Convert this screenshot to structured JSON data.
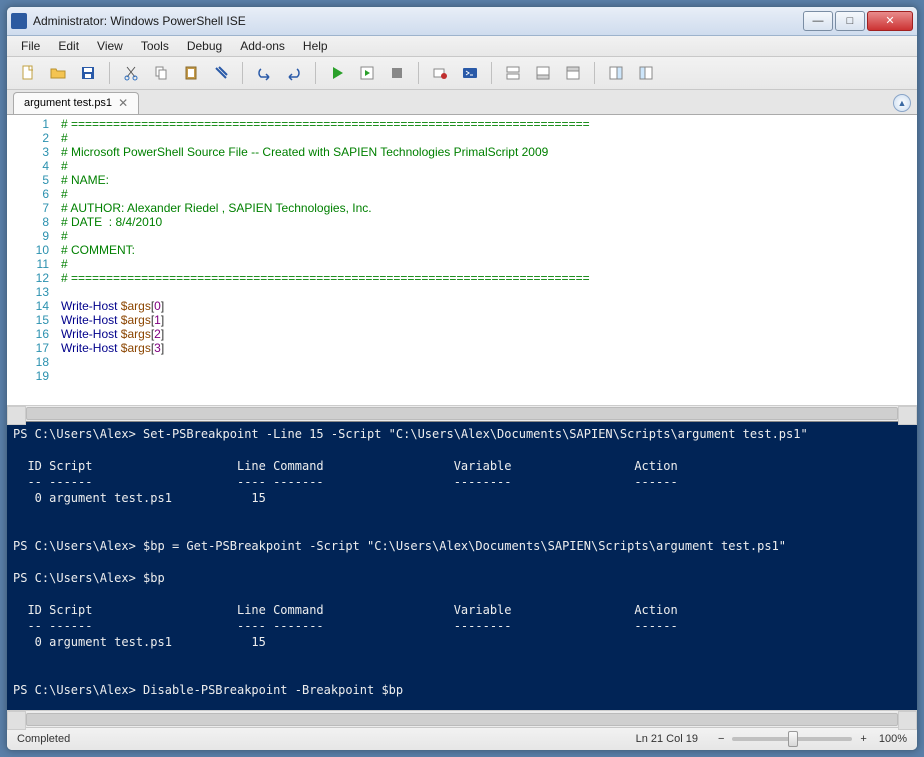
{
  "titlebar": {
    "title": "Administrator: Windows PowerShell ISE"
  },
  "menu": {
    "items": [
      "File",
      "Edit",
      "View",
      "Tools",
      "Debug",
      "Add-ons",
      "Help"
    ]
  },
  "tab": {
    "name": "argument test.ps1"
  },
  "editor": {
    "lines": [
      {
        "n": 1,
        "type": "comment",
        "text": "# =========================================================================="
      },
      {
        "n": 2,
        "type": "comment",
        "text": "# "
      },
      {
        "n": 3,
        "type": "comment",
        "text": "# Microsoft PowerShell Source File -- Created with SAPIEN Technologies PrimalScript 2009"
      },
      {
        "n": 4,
        "type": "comment",
        "text": "# "
      },
      {
        "n": 5,
        "type": "comment",
        "text": "# NAME: "
      },
      {
        "n": 6,
        "type": "comment",
        "text": "# "
      },
      {
        "n": 7,
        "type": "comment",
        "text": "# AUTHOR: Alexander Riedel , SAPIEN Technologies, Inc."
      },
      {
        "n": 8,
        "type": "comment",
        "text": "# DATE  : 8/4/2010"
      },
      {
        "n": 9,
        "type": "comment",
        "text": "# "
      },
      {
        "n": 10,
        "type": "comment",
        "text": "# COMMENT: "
      },
      {
        "n": 11,
        "type": "comment",
        "text": "# "
      },
      {
        "n": 12,
        "type": "comment",
        "text": "# =========================================================================="
      },
      {
        "n": 13,
        "type": "blank",
        "text": ""
      },
      {
        "n": 14,
        "type": "code",
        "cmd": "Write-Host",
        "var": "$args",
        "idx": "0"
      },
      {
        "n": 15,
        "type": "code",
        "cmd": "Write-Host",
        "var": "$args",
        "idx": "1"
      },
      {
        "n": 16,
        "type": "code",
        "cmd": "Write-Host",
        "var": "$args",
        "idx": "2"
      },
      {
        "n": 17,
        "type": "code",
        "cmd": "Write-Host",
        "var": "$args",
        "idx": "3"
      },
      {
        "n": 18,
        "type": "blank",
        "text": ""
      },
      {
        "n": 19,
        "type": "blank",
        "text": ""
      }
    ]
  },
  "console": {
    "prompt": "PS C:\\Users\\Alex>",
    "cmd1": "Set-PSBreakpoint -Line 15 -Script \"C:\\Users\\Alex\\Documents\\SAPIEN\\Scripts\\argument test.ps1\"",
    "header": "  ID Script                    Line Command                  Variable                 Action",
    "divider": "  -- ------                    ---- -------                  --------                 ------",
    "row1": "   0 argument test.ps1           15",
    "cmd2": "$bp = Get-PSBreakpoint -Script \"C:\\Users\\Alex\\Documents\\SAPIEN\\Scripts\\argument test.ps1\"",
    "cmd3": "$bp",
    "cmd4": "Disable-PSBreakpoint -Breakpoint $bp"
  },
  "status": {
    "left": "Completed",
    "pos": "Ln 21  Col 19",
    "zoom": "100%",
    "minus": "−",
    "plus": "+"
  },
  "icons": {
    "new": "new",
    "open": "open",
    "save": "save",
    "cut": "cut",
    "copy": "copy",
    "paste": "paste",
    "clear": "clear",
    "undo": "undo",
    "redo": "redo",
    "run": "run",
    "runsel": "runsel",
    "stop": "stop",
    "bp": "bp",
    "ps": "ps",
    "layout1": "l1",
    "layout2": "l2",
    "layout3": "l3",
    "panel1": "p1",
    "panel2": "p2"
  }
}
